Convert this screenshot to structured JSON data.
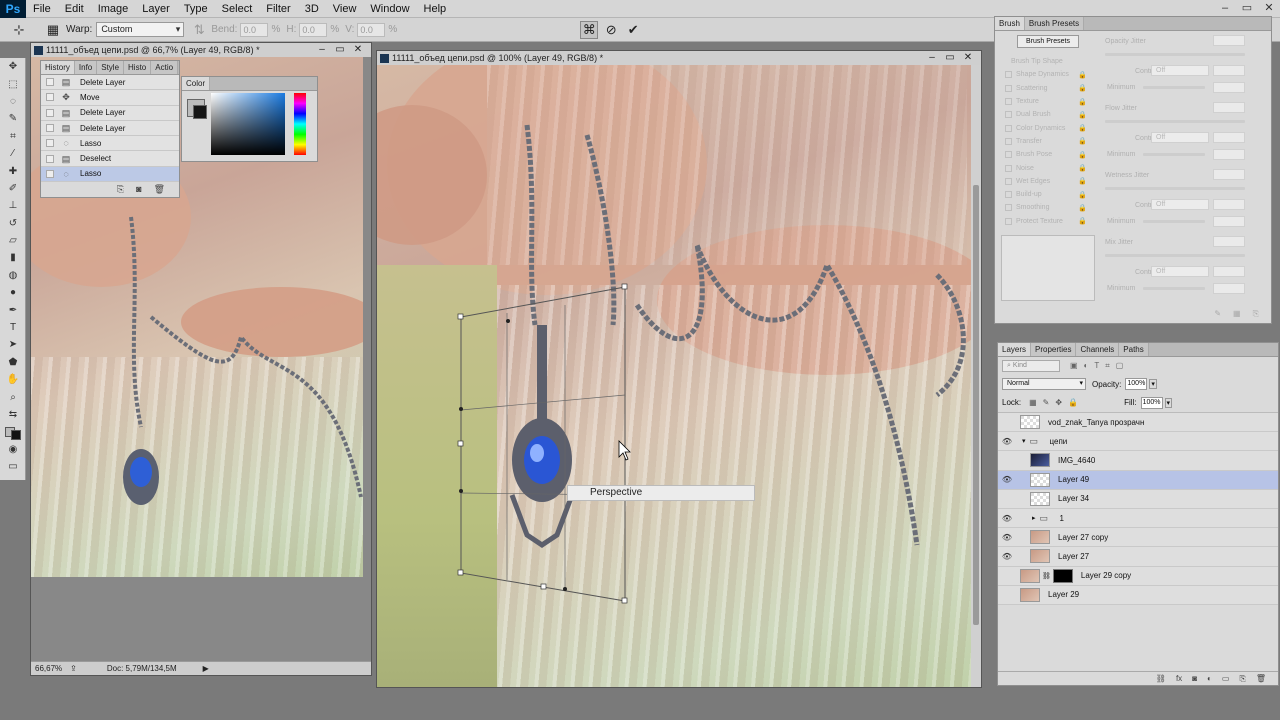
{
  "app": {
    "logo": "Ps"
  },
  "menu": [
    "File",
    "Edit",
    "Image",
    "Layer",
    "Type",
    "Select",
    "Filter",
    "3D",
    "View",
    "Window",
    "Help"
  ],
  "window_controls": [
    "–",
    "▭",
    "✕"
  ],
  "options": {
    "warp_label": "Warp:",
    "warp_value": "Custom",
    "bend_label": "Bend:",
    "bend_value": "0.0",
    "h_label": "H:",
    "h_value": "0.0",
    "v_label": "V:",
    "v_value": "0.0",
    "pct": "%",
    "cancel_icon": "cancel-transform-icon",
    "commit_icon": "commit-transform-icon"
  },
  "doc_left": {
    "title": "11111_объед цепи.psd @ 66,7% (Layer 49, RGB/8) *",
    "zoom": "66,67%",
    "doc_size": "Doc: 5,79M/134,5M"
  },
  "doc_main": {
    "title": "11111_объед цепи.psd @ 100% (Layer 49, RGB/8) *",
    "transform_tooltip": "Perspective"
  },
  "history_panel": {
    "tabs": [
      "History",
      "Info",
      "Style",
      "Histo",
      "Actio"
    ],
    "items": [
      {
        "label": "Delete Layer",
        "icon": "layer-icon"
      },
      {
        "label": "Move",
        "icon": "move-icon"
      },
      {
        "label": "Delete Layer",
        "icon": "layer-icon"
      },
      {
        "label": "Delete Layer",
        "icon": "layer-icon"
      },
      {
        "label": "Lasso",
        "icon": "lasso-icon"
      },
      {
        "label": "Deselect",
        "icon": "layer-icon"
      },
      {
        "label": "Lasso",
        "icon": "lasso-icon"
      }
    ]
  },
  "color_panel": {
    "tab": "Color"
  },
  "brush_panel": {
    "tabs": [
      "Brush",
      "Brush Presets"
    ],
    "presets_button": "Brush Presets",
    "options": [
      "Brush Tip Shape",
      "Shape Dynamics",
      "Scattering",
      "Texture",
      "Dual Brush",
      "Color Dynamics",
      "Transfer",
      "Brush Pose",
      "Noise",
      "Wet Edges",
      "Build-up",
      "Smoothing",
      "Protect Texture"
    ],
    "labels": {
      "opacity_jitter": "Opacity Jitter",
      "control": "Control:",
      "off": "Off",
      "minimum": "Minimum",
      "flow_jitter": "Flow Jitter",
      "wetness_jitter": "Wetness Jitter",
      "mix_jitter": "Mix Jitter"
    }
  },
  "layers_panel": {
    "tabs": [
      "Layers",
      "Properties",
      "Channels",
      "Paths"
    ],
    "kind": "Kind",
    "blend_mode": "Normal",
    "opacity_label": "Opacity:",
    "opacity": "100%",
    "lock_label": "Lock:",
    "fill_label": "Fill:",
    "fill": "100%",
    "layers": [
      {
        "name": "vod_znak_Tanya прозрачн",
        "visible": false,
        "thumb": "trans",
        "indent": 0
      },
      {
        "name": "цепи",
        "visible": true,
        "thumb": "folder",
        "indent": 0
      },
      {
        "name": "IMG_4640",
        "visible": false,
        "thumb": "dark",
        "indent": 1
      },
      {
        "name": "Layer 49",
        "visible": true,
        "thumb": "trans",
        "indent": 1,
        "selected": true
      },
      {
        "name": "Layer 34",
        "visible": false,
        "thumb": "trans",
        "indent": 1
      },
      {
        "name": "1",
        "visible": true,
        "thumb": "folder",
        "indent": 1
      },
      {
        "name": "Layer 27 copy",
        "visible": true,
        "thumb": "photo",
        "indent": 1
      },
      {
        "name": "Layer 27",
        "visible": true,
        "thumb": "photo",
        "indent": 1
      },
      {
        "name": "Layer 29 copy",
        "visible": false,
        "thumb": "mask",
        "indent": 0
      },
      {
        "name": "Layer 29",
        "visible": false,
        "thumb": "photo",
        "indent": 0
      }
    ]
  }
}
